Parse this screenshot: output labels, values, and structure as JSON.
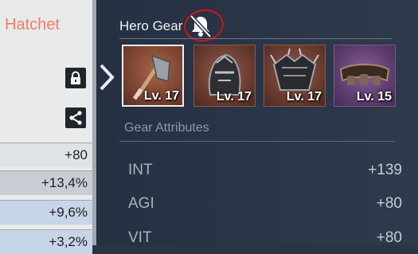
{
  "left_panel": {
    "weapon_title": "Hatchet",
    "stats": [
      "+80",
      "+13,4%",
      "+9,6%",
      "+3,2%"
    ]
  },
  "hero_gear": {
    "title": "Hero Gear",
    "items": [
      {
        "level": "Lv. 17",
        "icon": "hatchet-icon"
      },
      {
        "level": "Lv. 17",
        "icon": "helmet-icon"
      },
      {
        "level": "Lv. 17",
        "icon": "armor-icon"
      },
      {
        "level": "Lv. 15",
        "icon": "belt-icon"
      }
    ]
  },
  "gear_attributes": {
    "title": "Gear Attributes",
    "rows": [
      {
        "name": "INT",
        "value": "+139"
      },
      {
        "name": "AGI",
        "value": "+80"
      },
      {
        "name": "VIT",
        "value": "+80"
      }
    ]
  },
  "colors": {
    "accent": "#f07e63",
    "highlight_circle": "#d01414"
  }
}
